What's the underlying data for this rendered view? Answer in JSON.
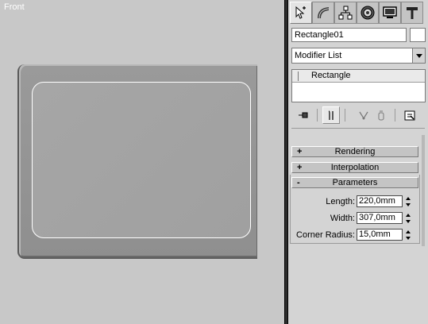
{
  "viewport": {
    "label": "Front"
  },
  "panel": {
    "tabs": [
      {
        "icon": "create-arrow-icon",
        "active": true
      },
      {
        "icon": "modify-icon",
        "active": false
      },
      {
        "icon": "hierarchy-icon",
        "active": false
      },
      {
        "icon": "motion-icon",
        "active": false
      },
      {
        "icon": "display-icon",
        "active": false
      },
      {
        "icon": "utilities-hammer-icon",
        "active": false
      }
    ],
    "object_name": "Rectangle01",
    "modifier_list": "Modifier List",
    "stack": {
      "items": [
        "Rectangle"
      ]
    },
    "rollouts": {
      "rendering": {
        "sign": "+",
        "title": "Rendering"
      },
      "interpolation": {
        "sign": "+",
        "title": "Interpolation"
      },
      "parameters": {
        "sign": "-",
        "title": "Parameters"
      }
    },
    "parameters": {
      "length": {
        "label": "Length:",
        "value": "220,0mm"
      },
      "width": {
        "label": "Width:",
        "value": "307,0mm"
      },
      "corner_radius": {
        "label": "Corner Radius:",
        "value": "15,0mm"
      }
    }
  },
  "colors": {
    "viewport_bg": "#c8c8c8",
    "panel_bg": "#d4d4d4",
    "object_face": "#a3a3a3",
    "spline_outline": "#ffffff"
  }
}
